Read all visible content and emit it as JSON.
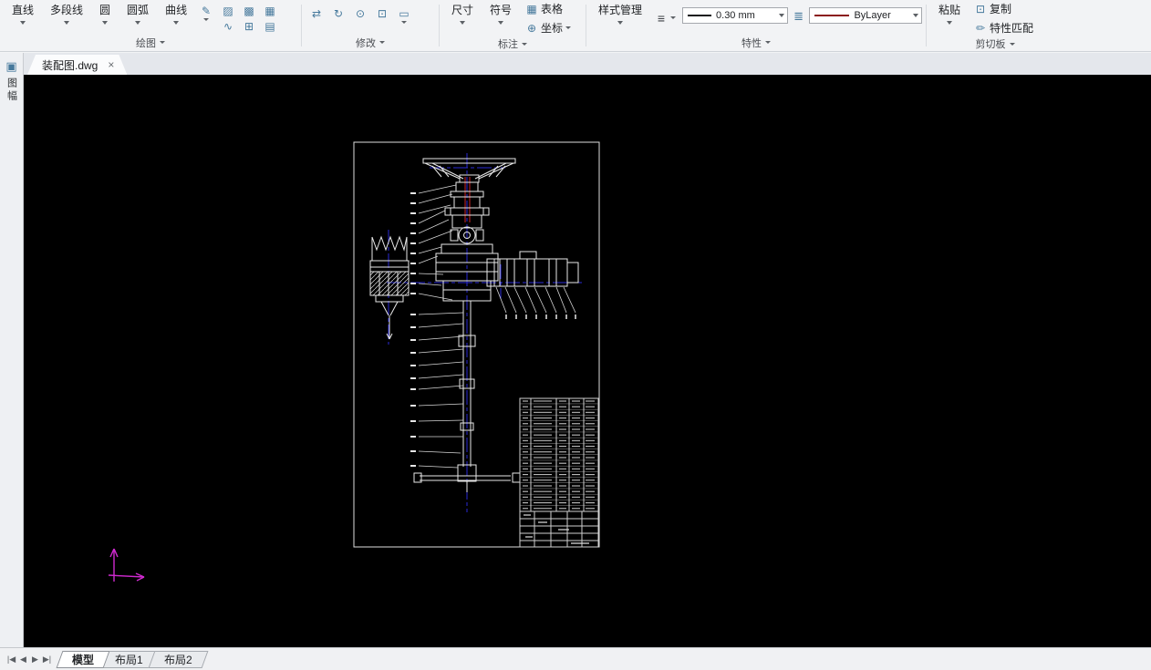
{
  "ribbon": {
    "draw": {
      "label": "绘图",
      "line": "直线",
      "polyline": "多段线",
      "circle": "圆",
      "arc": "圆弧",
      "curve": "曲线"
    },
    "modify": {
      "label": "修改"
    },
    "annotate": {
      "label": "标注",
      "dimension": "尺寸",
      "symbol": "符号",
      "table": "表格",
      "coordinate": "坐标"
    },
    "properties": {
      "label": "特性",
      "style_manager": "样式管理",
      "lineweight": "0.30 mm",
      "color": "ByLayer"
    },
    "clipboard": {
      "label": "剪切板",
      "paste": "粘贴",
      "copy": "复制",
      "match_properties": "特性匹配"
    }
  },
  "left_toolbar": {
    "sheet_label": "图幅"
  },
  "document_tab": {
    "title": "装配图.dwg",
    "close": "×"
  },
  "bottom_bar": {
    "nav_first": "|◀",
    "nav_prev": "◀",
    "nav_next": "▶",
    "nav_last": "▶|",
    "tabs": [
      {
        "label": "模型"
      },
      {
        "label": "布局1"
      },
      {
        "label": "布局2"
      }
    ]
  },
  "icons": {
    "sketch": "✎",
    "hatch": "▨",
    "fill": "▩",
    "region": "▦",
    "spline": "∿",
    "grid": "⊞",
    "pattern": "▤",
    "move": "⇄",
    "rotate": "↻",
    "circle_tool": "⊙",
    "copy_obj": "⊡",
    "rect": "▭",
    "table": "▦",
    "coordinate": "⊕",
    "menu": "≡",
    "list": "≣",
    "copy": "⊡",
    "match": "✏",
    "sheet": "▣"
  },
  "colors": {
    "crosshair": "#2a2ad6",
    "ucs": "#d02ad0",
    "bylayer_line": "#8b1a1a",
    "canvas": "#000000"
  }
}
